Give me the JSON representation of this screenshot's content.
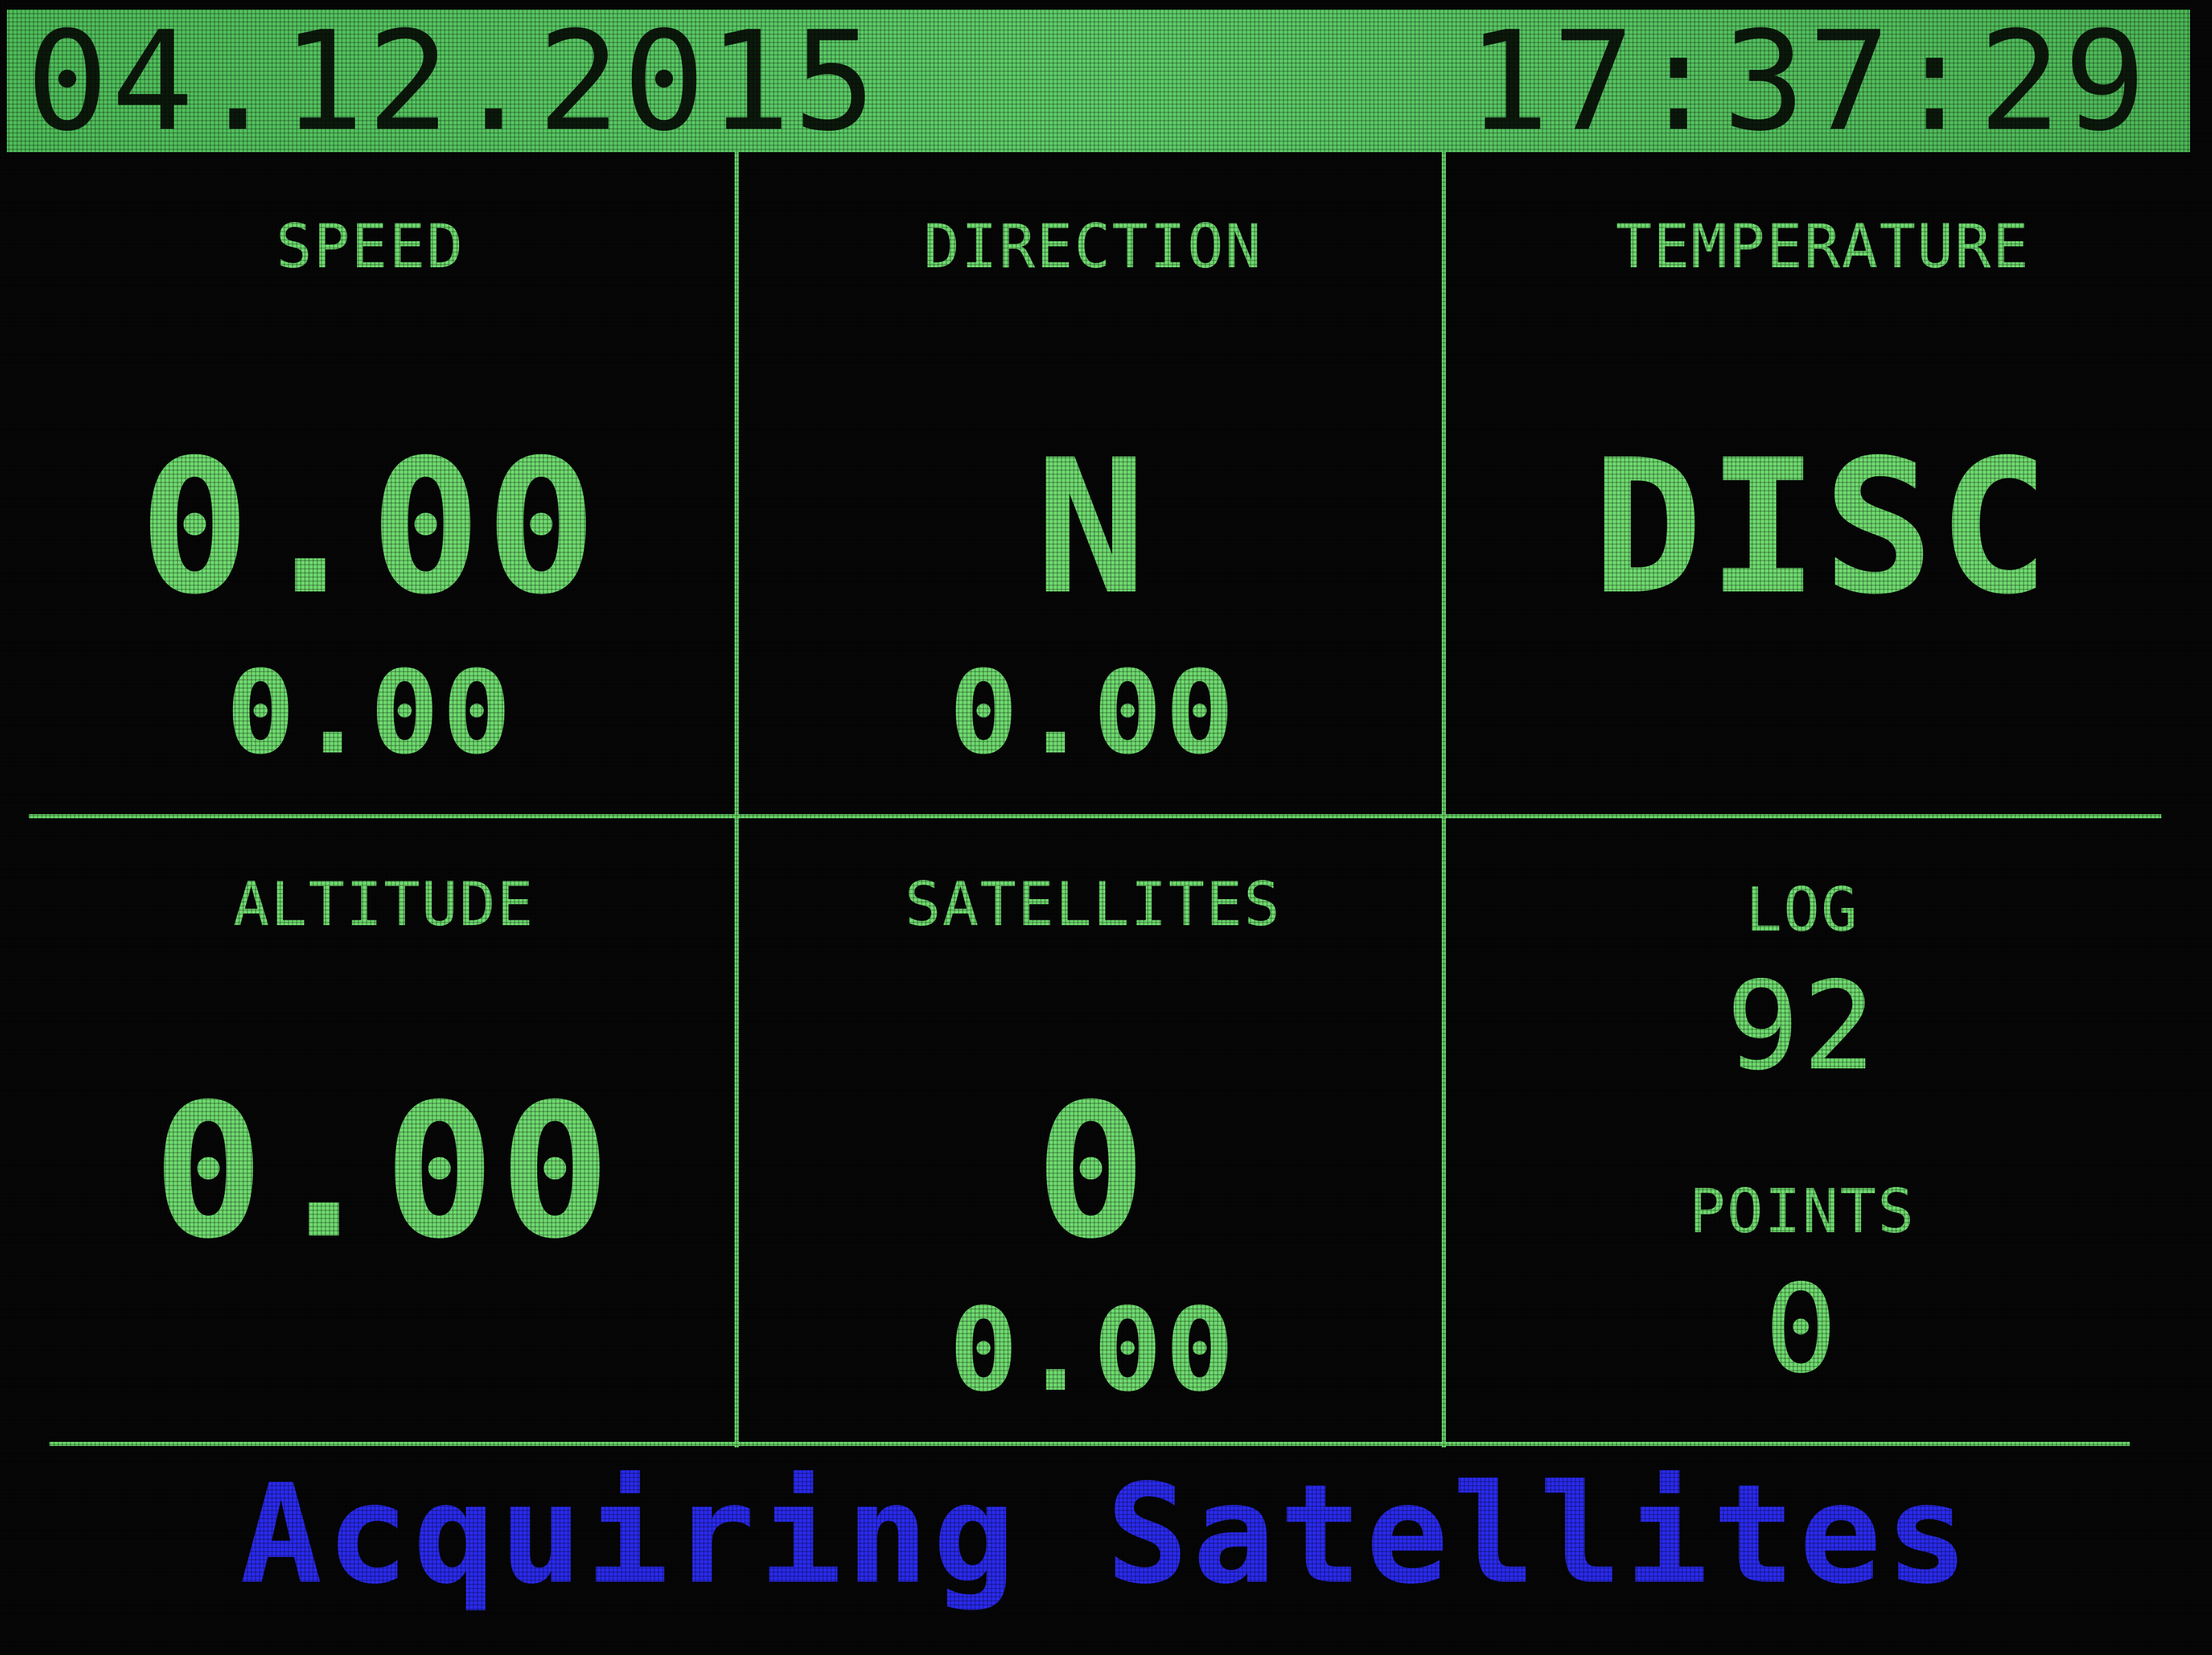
{
  "header": {
    "date": "04.12.2015",
    "time": "17:37:29"
  },
  "panels": {
    "speed": {
      "title": "SPEED",
      "value": "0.00",
      "sub_value": "0.00"
    },
    "direction": {
      "title": "DIRECTION",
      "value": "N",
      "sub_value": "0.00"
    },
    "temperature": {
      "title": "TEMPERATURE",
      "value": "DISC"
    },
    "altitude": {
      "title": "ALTITUDE",
      "value": "0.00"
    },
    "satellites": {
      "title": "SATELLITES",
      "value": "0",
      "sub_value": "0.00"
    },
    "log": {
      "title": "LOG",
      "value": "92",
      "points_title": "POINTS",
      "points_value": "0"
    }
  },
  "status": {
    "message": "Acquiring Satellites"
  },
  "colors": {
    "header_bg": "#5fd06a",
    "header_text": "#0c1a0c",
    "label_green": "#6fdc6f",
    "grid_green": "#6ad86a",
    "status_blue": "#2a2af0",
    "background": "#060606"
  }
}
